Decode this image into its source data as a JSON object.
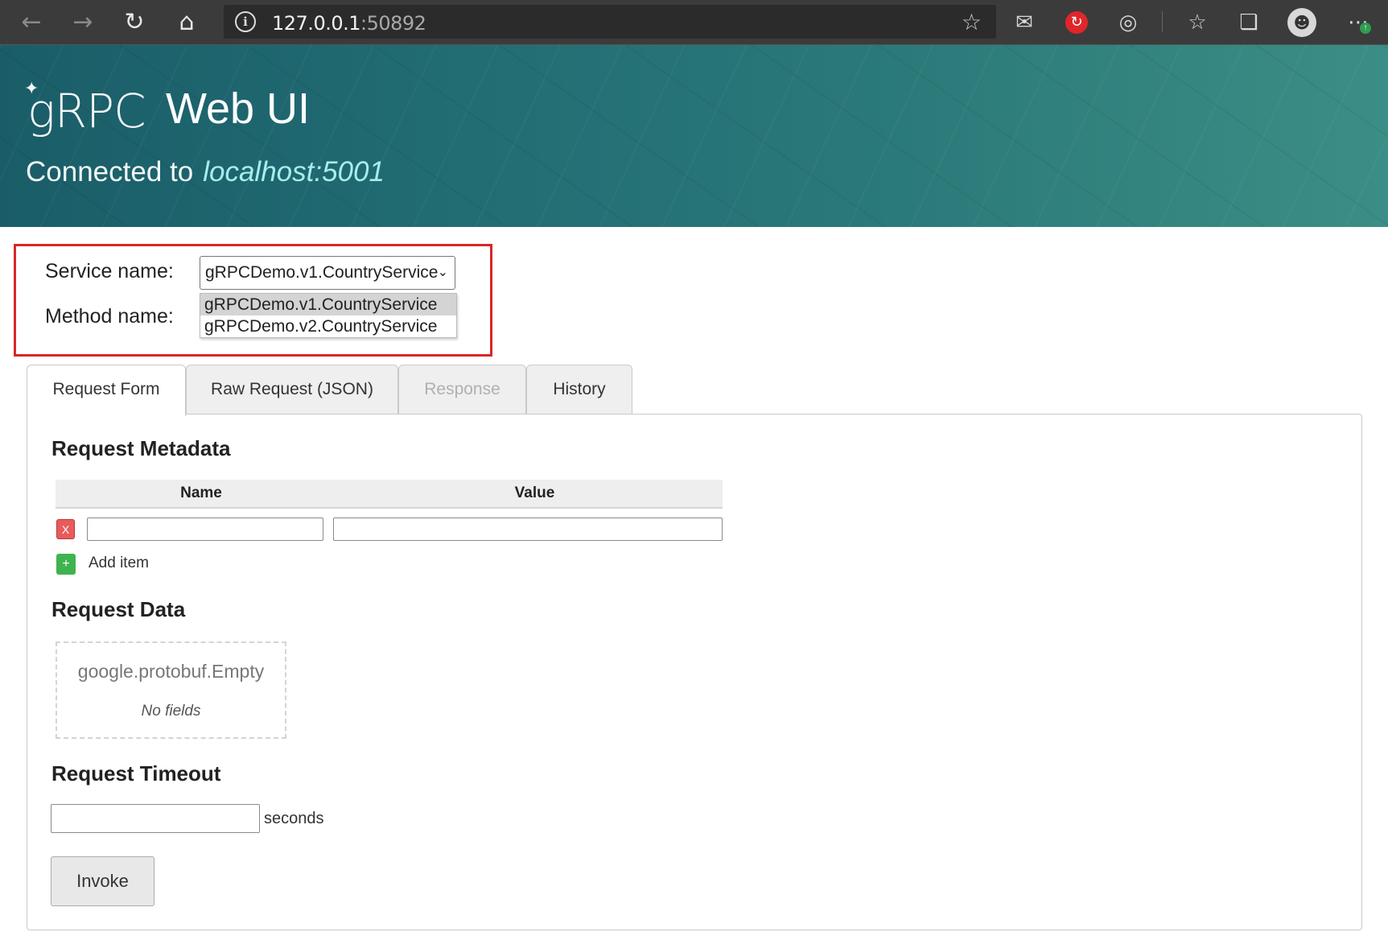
{
  "browser": {
    "url_host": "127.0.0.1",
    "url_port": ":50892"
  },
  "header": {
    "logo_text": "gRPC",
    "title": "Web UI",
    "connected_prefix": "Connected to",
    "connected_host": "localhost:5001"
  },
  "service_form": {
    "service_label": "Service name:",
    "method_label": "Method name:",
    "selected_service": "gRPCDemo.v1.CountryService",
    "options": [
      "gRPCDemo.v1.CountryService",
      "gRPCDemo.v2.CountryService"
    ]
  },
  "tabs": [
    {
      "label": "Request Form",
      "state": "active"
    },
    {
      "label": "Raw Request (JSON)",
      "state": "normal"
    },
    {
      "label": "Response",
      "state": "disabled"
    },
    {
      "label": "History",
      "state": "normal"
    }
  ],
  "metadata": {
    "heading": "Request Metadata",
    "col_name": "Name",
    "col_value": "Value",
    "remove_label": "X",
    "add_icon": "+",
    "add_label": "Add item"
  },
  "request_data": {
    "heading": "Request Data",
    "message_type": "google.protobuf.Empty",
    "no_fields": "No fields"
  },
  "timeout": {
    "heading": "Request Timeout",
    "unit": "seconds"
  },
  "invoke_label": "Invoke",
  "colors": {
    "highlight_border": "#d92626",
    "banner": "#226d74",
    "remove_button": "#e85b5b",
    "add_button": "#3fb34f"
  }
}
